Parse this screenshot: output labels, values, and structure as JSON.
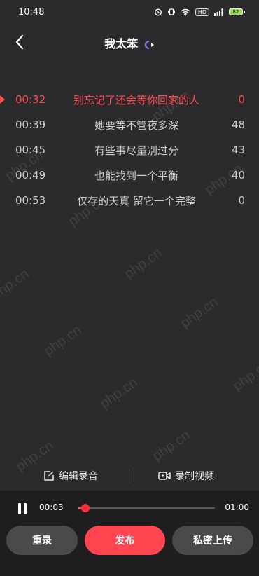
{
  "status": {
    "time": "10:48",
    "icons": [
      "alarm-icon",
      "vibrate-icon",
      "wifi-icon",
      "hd-icon",
      "signal-icon",
      "battery-icon"
    ],
    "hd_label": "HD",
    "battery_label": "82"
  },
  "nav": {
    "title": "我太笨",
    "back_icon": "chevron-left-icon"
  },
  "lyrics": [
    {
      "time": "00:32",
      "text": "别忘记了还会等你回家的人",
      "count": "0",
      "active": true
    },
    {
      "time": "00:39",
      "text": "她要等不管夜多深",
      "count": "48",
      "active": false
    },
    {
      "time": "00:45",
      "text": "有些事尽量别过分",
      "count": "43",
      "active": false
    },
    {
      "time": "00:49",
      "text": "也能找到一个平衡",
      "count": "40",
      "active": false
    },
    {
      "time": "00:53",
      "text": "仅存的天真 留它一个完整",
      "count": "0",
      "active": false
    }
  ],
  "watermark": "php.cn",
  "tools": {
    "edit_label": "编辑录音",
    "video_label": "录制视频"
  },
  "player": {
    "current_time": "00:03",
    "total_time": "01:00",
    "progress": 0.05
  },
  "actions": {
    "retake_label": "重录",
    "publish_label": "发布",
    "private_label": "私密上传"
  },
  "colors": {
    "accent": "#ff4650",
    "background": "#2b2b2d"
  }
}
